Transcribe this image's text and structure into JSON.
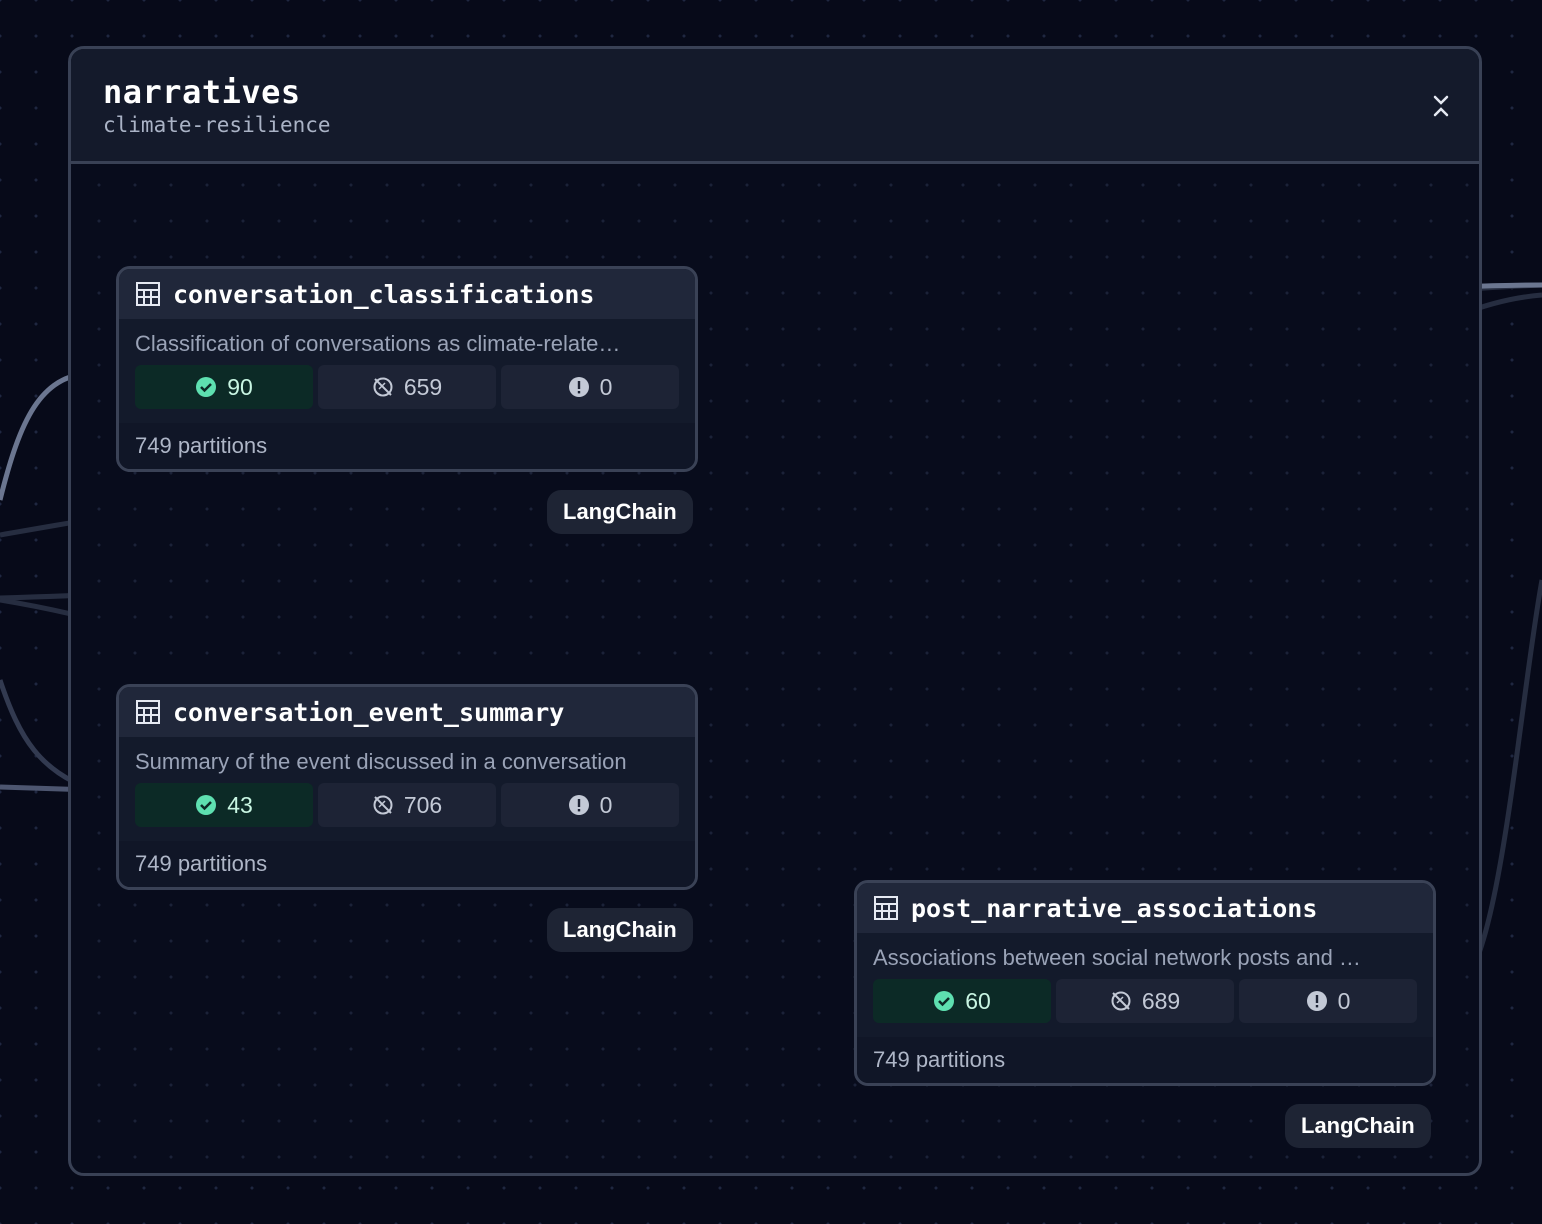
{
  "group": {
    "title": "narratives",
    "subtitle": "climate-resilience"
  },
  "icons": {
    "table": "table-icon",
    "success": "check-circle-icon",
    "skipped": "slash-circle-icon",
    "error": "exclamation-circle-icon",
    "collapse": "chevrons-collapse-icon"
  },
  "colors": {
    "background": "#070a19",
    "node_header": "#20273a",
    "success_bg": "#0c2a26",
    "success_icon": "#5ee0b0",
    "edge": "#636e87",
    "edge_faint": "#262d40"
  },
  "nodes": [
    {
      "name": "conversation_classifications",
      "description": "Classification of conversations as climate-relate…",
      "success": "90",
      "skipped": "659",
      "errors": "0",
      "partitions": "749 partitions",
      "tag": "LangChain"
    },
    {
      "name": "conversation_event_summary",
      "description": "Summary of the event discussed in a conversation",
      "success": "43",
      "skipped": "706",
      "errors": "0",
      "partitions": "749 partitions",
      "tag": "LangChain"
    },
    {
      "name": "post_narrative_associations",
      "description": "Associations between social network posts and …",
      "success": "60",
      "skipped": "689",
      "errors": "0",
      "partitions": "749 partitions",
      "tag": "LangChain"
    }
  ]
}
